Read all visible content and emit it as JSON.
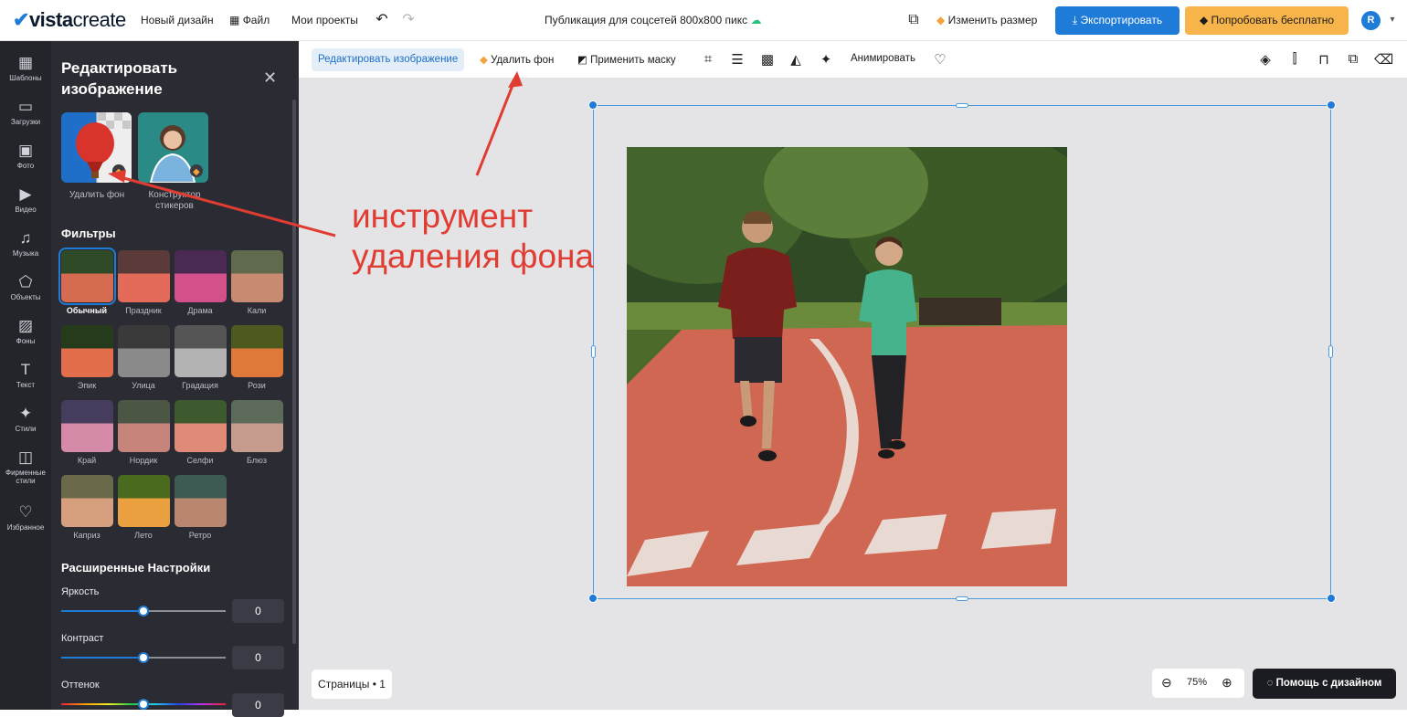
{
  "topbar": {
    "logo_bold": "vista",
    "logo_light": "create",
    "new_design": "Новый дизайн",
    "file": "Файл",
    "my_projects": "Мои проекты",
    "doc_title": "Публикация для соцсетей 800x800 пикс",
    "resize": "Изменить размер",
    "export": "Экспортировать",
    "try_free": "Попробовать бесплатно",
    "avatar_letter": "R"
  },
  "rail": {
    "items": [
      {
        "label": "Шаблоны",
        "icon": "templates-icon"
      },
      {
        "label": "Загрузки",
        "icon": "folder-icon"
      },
      {
        "label": "Фото",
        "icon": "photo-icon"
      },
      {
        "label": "Видео",
        "icon": "video-icon"
      },
      {
        "label": "Музыка",
        "icon": "music-icon"
      },
      {
        "label": "Объекты",
        "icon": "objects-icon"
      },
      {
        "label": "Фоны",
        "icon": "backgrounds-icon"
      },
      {
        "label": "Текст",
        "icon": "text-icon"
      },
      {
        "label": "Стили",
        "icon": "styles-icon"
      },
      {
        "label": "Фирменные стили",
        "icon": "brand-icon"
      },
      {
        "label": "Избранное",
        "icon": "heart-icon"
      }
    ]
  },
  "panel": {
    "title": "Редактировать изображение",
    "tools": [
      {
        "label": "Удалить фон"
      },
      {
        "label": "Конструктор стикеров"
      }
    ],
    "filters_title": "Фильтры",
    "filters": [
      "Обычный",
      "Праздник",
      "Драма",
      "Кали",
      "Эпик",
      "Улица",
      "Градация",
      "Рози",
      "Край",
      "Нордик",
      "Селфи",
      "Блюз",
      "Каприз",
      "Лето",
      "Ретро"
    ],
    "selected_filter": "Обычный",
    "advanced_title": "Расширенные Настройки",
    "sliders": [
      {
        "label": "Яркость",
        "value": "0",
        "level": 0.5
      },
      {
        "label": "Контраст",
        "value": "0",
        "level": 0.5
      },
      {
        "label": "Оттенок",
        "value": "0",
        "level": 0.5
      }
    ]
  },
  "toolbar": {
    "edit_image": "Редактировать изображение",
    "remove_bg": "Удалить фон",
    "apply_mask": "Применить маску",
    "animate": "Анимировать"
  },
  "annotation": {
    "line1": "инструмент",
    "line2": "удаления фона",
    "color": "#e03c32"
  },
  "canvas": {
    "pages": "Страницы • 1",
    "zoom": "75%",
    "help": "Помощь с дизайном"
  },
  "colors": {
    "accent": "#1f7bd8",
    "try_button": "#f7b44a",
    "panel_bg": "#2b2b33"
  }
}
